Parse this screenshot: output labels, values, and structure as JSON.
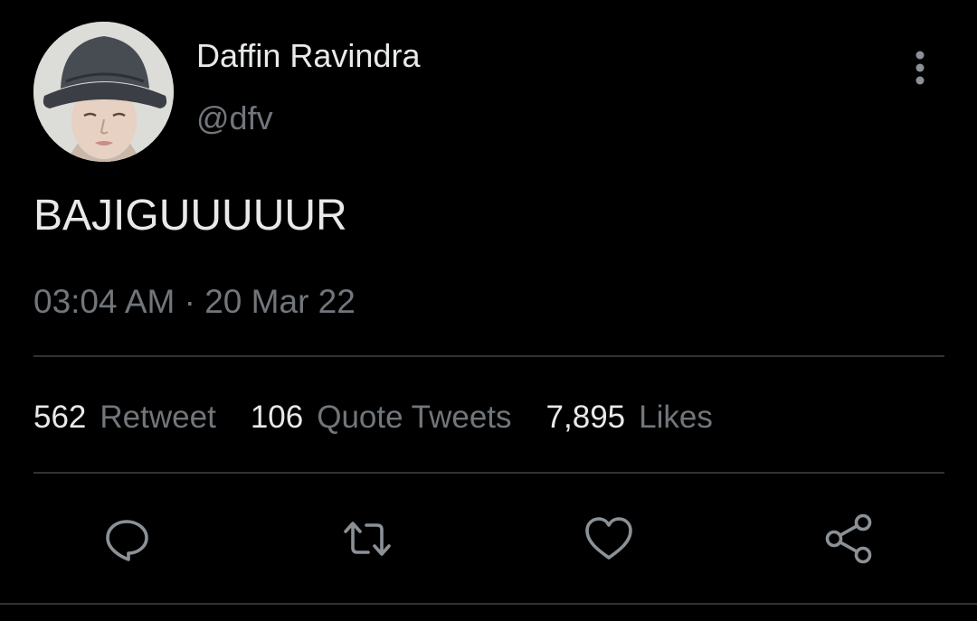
{
  "tweet": {
    "author": {
      "display_name": "Daffin Ravindra",
      "handle": "@dfv",
      "avatar_icon": "profile-photo"
    },
    "text": "BAJIGUUUUUR",
    "timestamp": {
      "time": "03:04 AM",
      "separator": "·",
      "date": "20 Mar 22"
    },
    "stats": {
      "retweets": {
        "count": "562",
        "label": "Retweet"
      },
      "quote_tweets": {
        "count": "106",
        "label": "Quote Tweets"
      },
      "likes": {
        "count": "7,895",
        "label": "Likes"
      }
    },
    "actions": [
      "reply-icon",
      "retweet-icon",
      "like-icon",
      "share-icon"
    ],
    "more_icon": "more-vertical-icon"
  },
  "colors": {
    "background": "#000000",
    "primary_text": "#e7e9ea",
    "secondary_text": "#71767b",
    "divider": "#2f3336"
  }
}
